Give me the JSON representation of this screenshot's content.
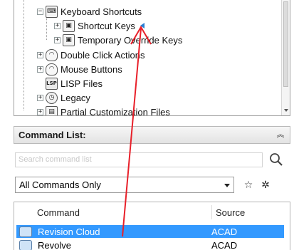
{
  "tree": {
    "items": [
      {
        "label": "Keyboard Shortcuts",
        "icon": "keyboard-icon"
      },
      {
        "label": "Shortcut Keys",
        "icon": "shortcut-key-icon"
      },
      {
        "label": "Temporary Override Keys",
        "icon": "override-key-icon"
      },
      {
        "label": "Double Click Actions",
        "icon": "double-click-icon"
      },
      {
        "label": "Mouse Buttons",
        "icon": "mouse-icon"
      },
      {
        "label": "LISP Files",
        "icon": "lisp-file-icon"
      },
      {
        "label": "Legacy",
        "icon": "legacy-clock-icon"
      },
      {
        "label": "Partial Customization Files",
        "icon": "partial-cui-icon"
      }
    ]
  },
  "command_list": {
    "title": "Command List:",
    "search_placeholder": "Search command list",
    "filter_value": "All Commands Only",
    "columns": [
      "Command",
      "Source"
    ],
    "rows": [
      {
        "command": "Revision Cloud",
        "source": "ACAD",
        "selected": true
      },
      {
        "command": "Revolve",
        "source": "ACAD",
        "selected": false
      }
    ]
  },
  "colors": {
    "selection": "#3399ff",
    "annotation_arrow": "#e8202a"
  }
}
